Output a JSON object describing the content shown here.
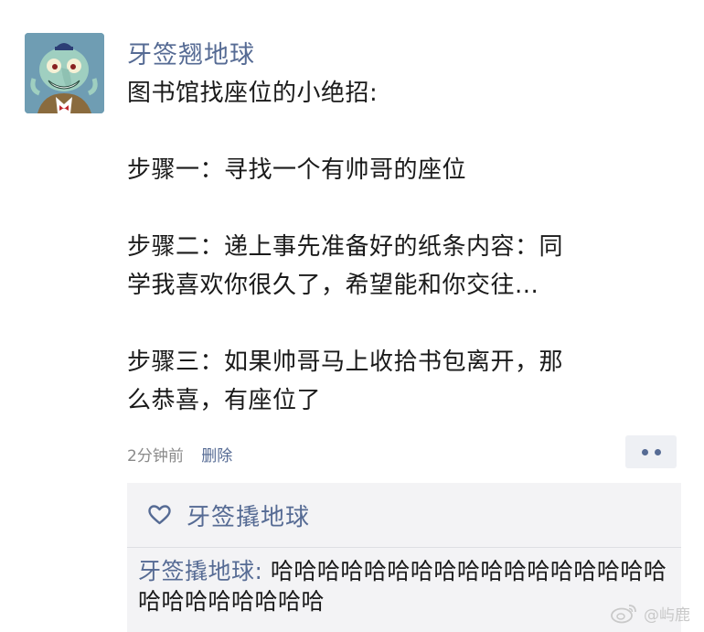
{
  "post": {
    "author": "牙签翘地球",
    "title": "图书馆找座位的小绝招:",
    "step1": "步骤一：寻找一个有帅哥的座位",
    "step2_line1": "步骤二：递上事先准备好的纸条内容：同",
    "step2_line2": "学我喜欢你很久了，希望能和你交往...",
    "step3_line1": "步骤三：如果帅哥马上收拾书包离开，那",
    "step3_line2": "么恭喜，有座位了",
    "time": "2分钟前",
    "delete_label": "删除"
  },
  "interactions": {
    "like_name": "牙签撬地球",
    "comment_author": "牙签撬地球:",
    "comment_text": " 哈哈哈哈哈哈哈哈哈哈哈哈哈哈哈哈哈哈哈哈哈哈哈哈哈"
  },
  "watermark": {
    "text": "@屿鹿",
    "icon": "weibo-icon"
  },
  "colors": {
    "link": "#566b94",
    "comment_bg": "#f3f3f5",
    "avatar_bg": "#6f9db3"
  }
}
